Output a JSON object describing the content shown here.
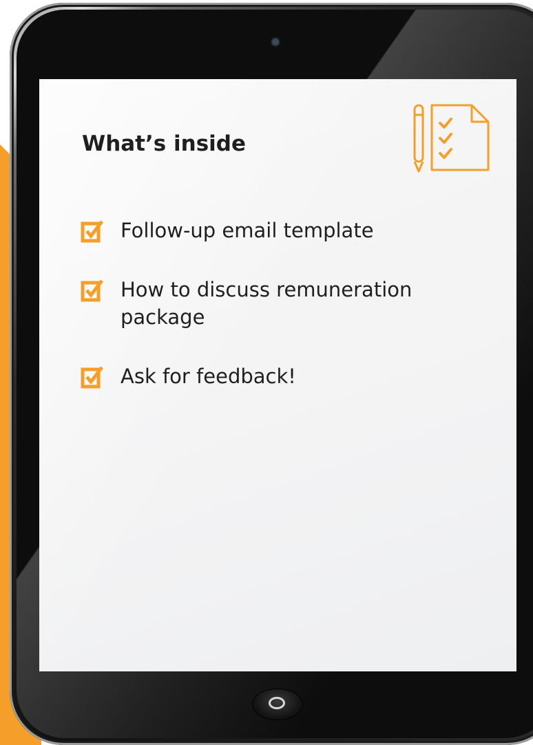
{
  "title": "What’s inside",
  "header_icon": "checklist-document-with-pencil-icon",
  "check_icon": "checked-box-icon",
  "accent_color": "#f59f2a",
  "items": [
    {
      "lines": [
        "Follow-up email template"
      ]
    },
    {
      "lines": [
        "How to discuss remuneration",
        "package"
      ]
    },
    {
      "lines": [
        "Ask for feedback!"
      ]
    }
  ]
}
